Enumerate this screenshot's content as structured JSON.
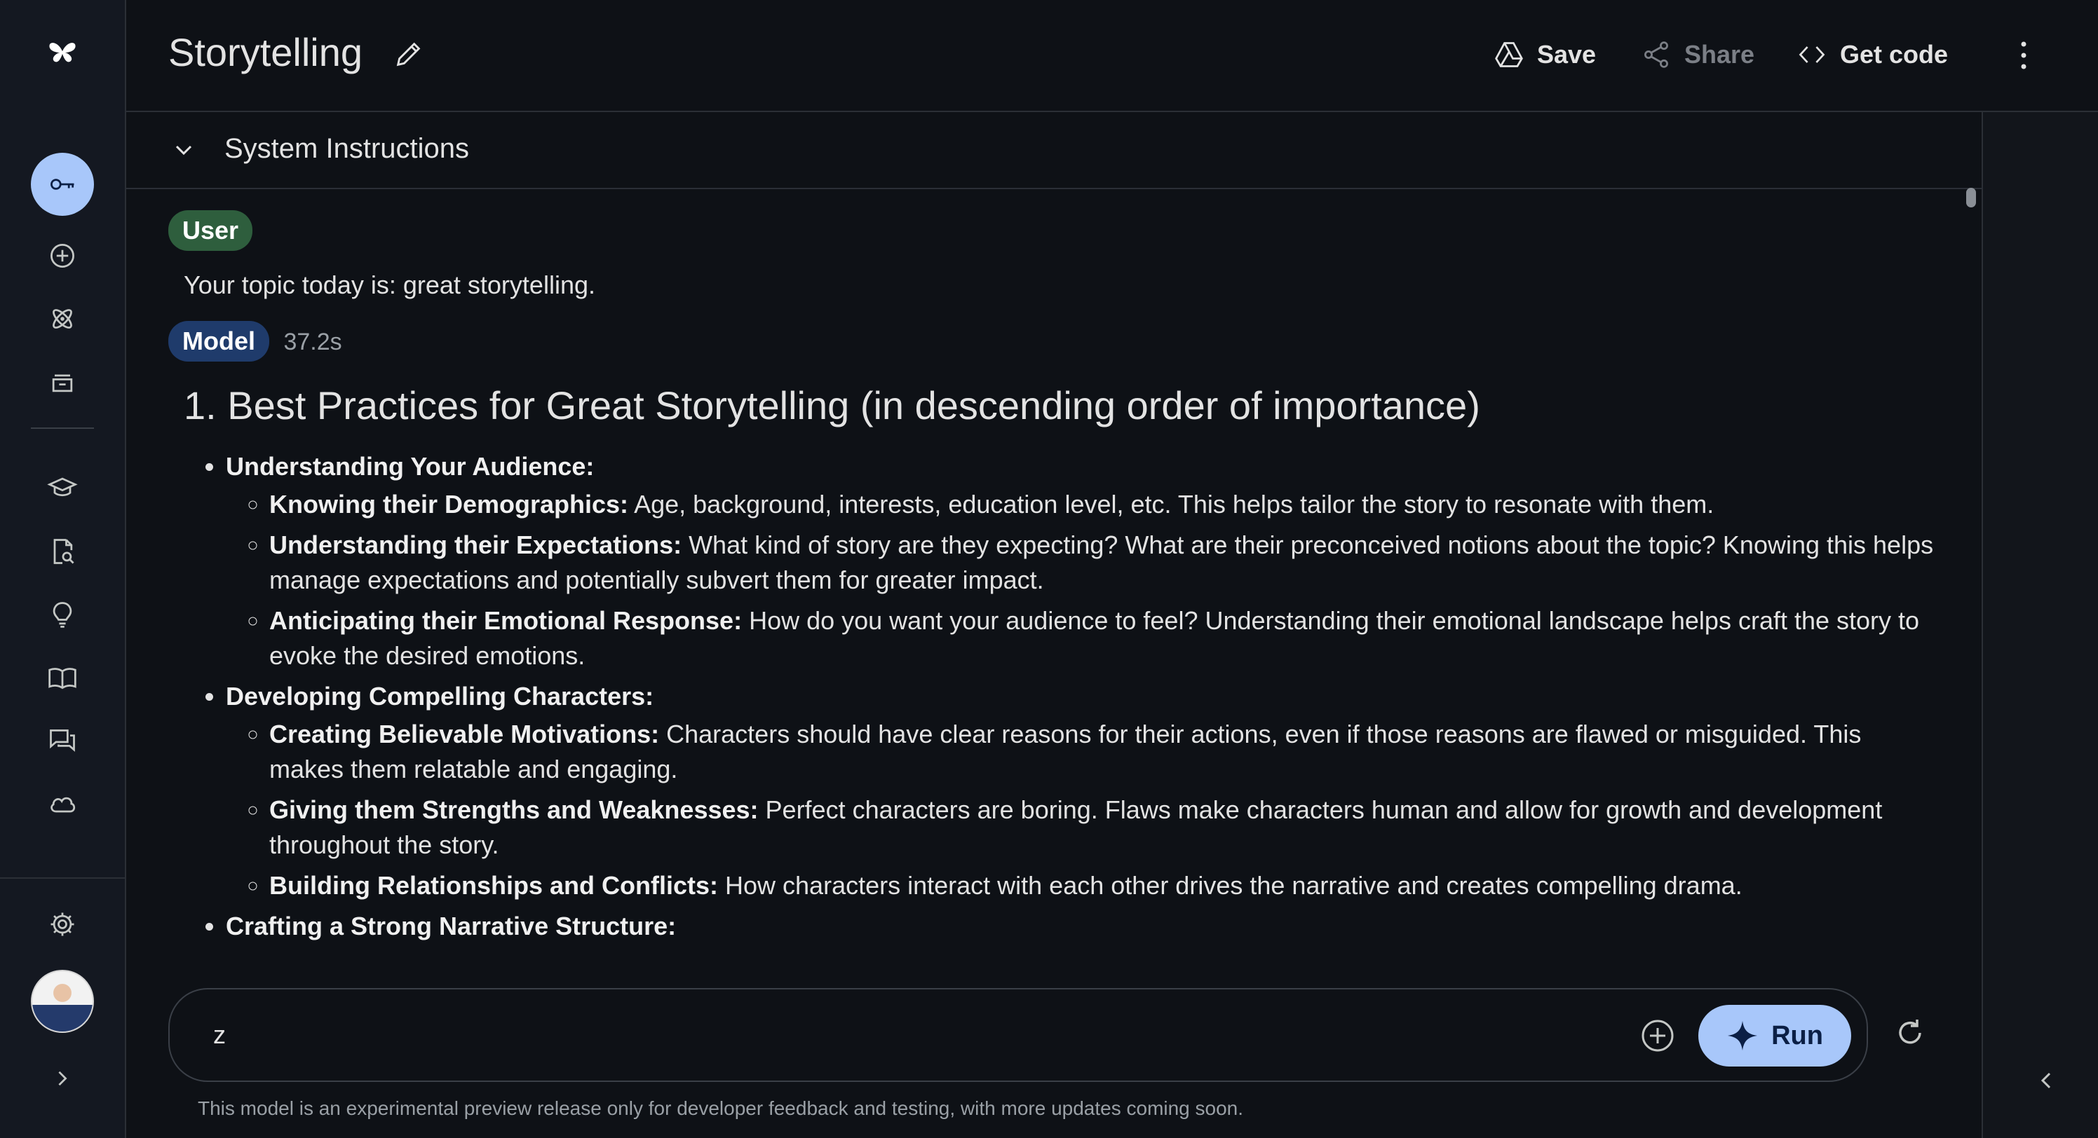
{
  "header": {
    "title": "Storytelling",
    "save_label": "Save",
    "share_label": "Share",
    "getcode_label": "Get code"
  },
  "system_instructions": {
    "label": "System Instructions"
  },
  "chat": {
    "user_chip": "User",
    "user_message": "Your topic today is: great storytelling.",
    "model_chip": "Model",
    "model_time": "37.2s",
    "heading": "1. Best Practices for Great Storytelling (in descending order of importance)",
    "sections": [
      {
        "title": "Understanding Your Audience:",
        "items": [
          {
            "term": "Knowing their Demographics:",
            "text": " Age, background, interests, education level, etc. This helps tailor the story to resonate with them."
          },
          {
            "term": "Understanding their Expectations:",
            "text": " What kind of story are they expecting? What are their preconceived notions about the topic? Knowing this helps manage expectations and potentially subvert them for greater impact."
          },
          {
            "term": "Anticipating their Emotional Response:",
            "text": " How do you want your audience to feel? Understanding their emotional landscape helps craft the story to evoke the desired emotions."
          }
        ]
      },
      {
        "title": "Developing Compelling Characters:",
        "items": [
          {
            "term": "Creating Believable Motivations:",
            "text": " Characters should have clear reasons for their actions, even if those reasons are flawed or misguided. This makes them relatable and engaging."
          },
          {
            "term": "Giving them Strengths and Weaknesses:",
            "text": " Perfect characters are boring. Flaws make characters human and allow for growth and development throughout the story."
          },
          {
            "term": "Building Relationships and Conflicts:",
            "text": " How characters interact with each other drives the narrative and creates compelling drama."
          }
        ]
      },
      {
        "title": "Crafting a Strong Narrative Structure:",
        "items": []
      }
    ]
  },
  "prompt": {
    "value": "z",
    "run_label": "Run"
  },
  "disclaimer": "This model is an experimental preview release only for developer feedback and testing, with more updates coming soon.",
  "colors": {
    "accent": "#a8c7fa",
    "user_chip": "#2e5e3d",
    "model_chip": "#1f3b6b",
    "background": "#0e1116"
  }
}
